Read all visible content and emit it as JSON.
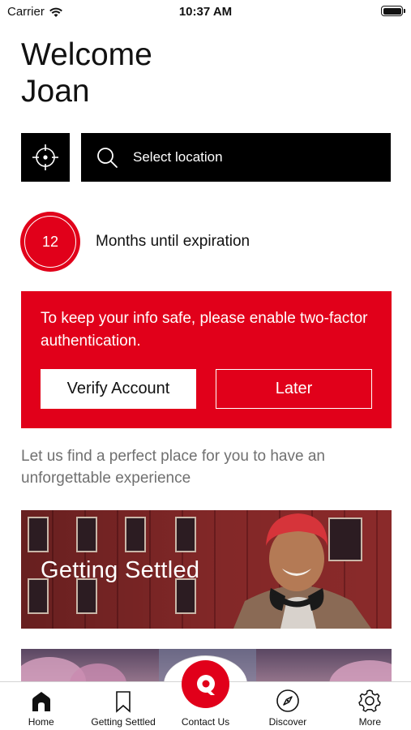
{
  "status_bar": {
    "carrier": "Carrier",
    "time": "10:37 AM"
  },
  "welcome": {
    "line1": "Welcome",
    "line2": "Joan"
  },
  "location": {
    "locate_icon": "crosshair-icon",
    "search_icon": "search-icon",
    "placeholder": "Select location"
  },
  "expiration": {
    "months": "12",
    "label": "Months until expiration"
  },
  "two_factor": {
    "message": "To keep your info safe, please enable two-factor authentication.",
    "verify_label": "Verify Account",
    "later_label": "Later"
  },
  "tagline": "Let us find a perfect place for you to have an unforgettable experience",
  "cards": [
    {
      "title": "Getting Settled"
    },
    {
      "title": ""
    }
  ],
  "tab_bar": {
    "items": [
      {
        "label": "Home",
        "icon": "home-icon",
        "active": true
      },
      {
        "label": "Getting Settled",
        "icon": "bookmark-icon",
        "active": false
      },
      {
        "label": "Contact Us",
        "icon": "chat-icon",
        "active": false
      },
      {
        "label": "Discover",
        "icon": "compass-icon",
        "active": false
      },
      {
        "label": "More",
        "icon": "gear-icon",
        "active": false
      }
    ]
  },
  "colors": {
    "brand_red": "#e1001a",
    "black": "#000000",
    "tagline_gray": "#707070"
  }
}
